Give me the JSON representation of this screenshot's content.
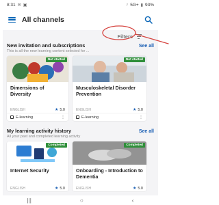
{
  "status_bar": {
    "time": "8:31",
    "network": "5G+",
    "battery": "93%"
  },
  "app_bar": {
    "title": "All channels"
  },
  "filters": {
    "label": "Filters"
  },
  "section1": {
    "title": "New invitation and subscriptions",
    "see_all": "See all",
    "subtitle": "This is all the new learning content selected for ...",
    "cards": [
      {
        "badge": "Not started",
        "title": "Dimensions of Diversity",
        "language": "ENGLISH",
        "rating": "5.0",
        "type": "E-learning"
      },
      {
        "badge": "Not started",
        "title": "Musculoskeletal Disorder Prevention",
        "language": "ENGLISH",
        "rating": "5.0",
        "type": "E-learning"
      }
    ]
  },
  "section2": {
    "title": "My learning activity history",
    "see_all": "See all",
    "subtitle": "All your past and completed learning activity",
    "cards": [
      {
        "badge": "Completed",
        "title": "Internet Security",
        "language": "ENGLISH",
        "rating": "5.0"
      },
      {
        "badge": "Completed",
        "title": "Onboarding - Introduction to Dementia",
        "language": "ENGLISH",
        "rating": "5.0"
      }
    ]
  },
  "colors": {
    "accent": "#1a5fb4",
    "badge_green": "#2f8f3a",
    "annotation_red": "#d64541"
  }
}
